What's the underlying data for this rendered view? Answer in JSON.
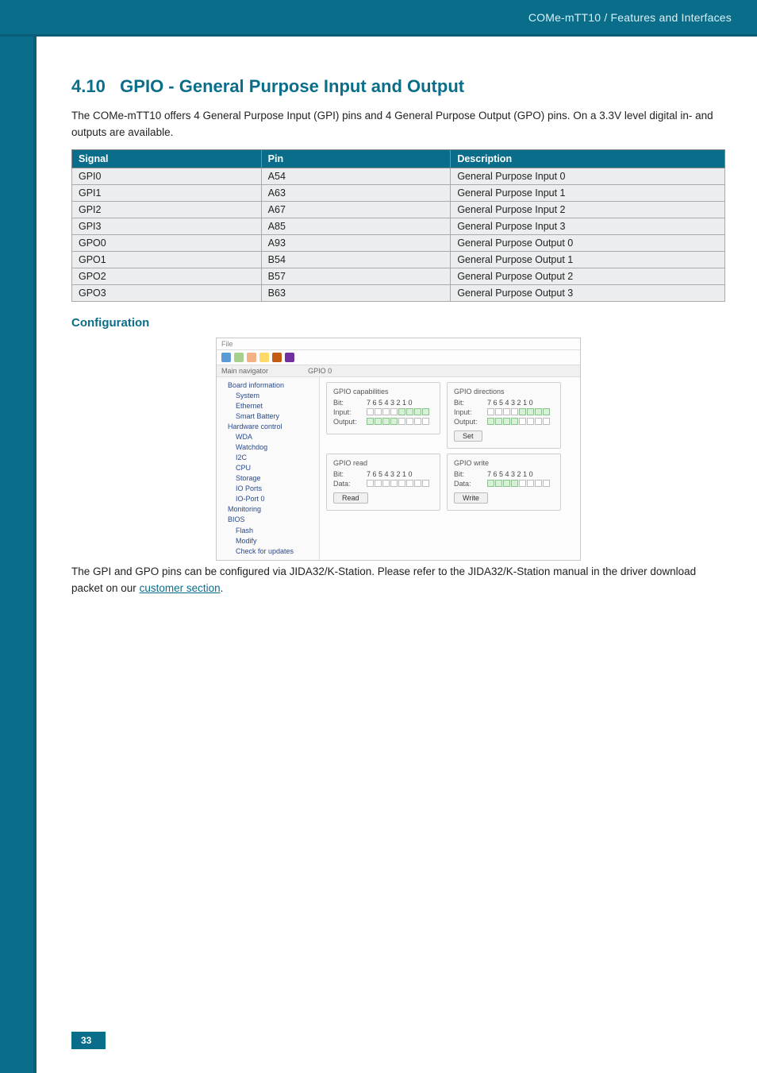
{
  "header": {
    "breadcrumb": "COMe-mTT10 / Features and Interfaces"
  },
  "section": {
    "number": "4.10",
    "title": "GPIO - General Purpose Input and Output",
    "intro": "The COMe-mTT10 offers 4 General Purpose Input (GPI) pins and 4 General Purpose Output (GPO) pins. On a 3.3V level digital in- and outputs are available."
  },
  "table": {
    "headers": {
      "signal": "Signal",
      "pin": "Pin",
      "desc": "Description"
    },
    "rows": [
      {
        "signal": "GPI0",
        "pin": "A54",
        "desc": "General Purpose Input 0"
      },
      {
        "signal": "GPI1",
        "pin": "A63",
        "desc": "General Purpose Input 1"
      },
      {
        "signal": "GPI2",
        "pin": "A67",
        "desc": "General Purpose Input 2"
      },
      {
        "signal": "GPI3",
        "pin": "A85",
        "desc": "General Purpose Input 3"
      },
      {
        "signal": "GPO0",
        "pin": "A93",
        "desc": "General Purpose Output 0"
      },
      {
        "signal": "GPO1",
        "pin": "B54",
        "desc": "General Purpose Output 1"
      },
      {
        "signal": "GPO2",
        "pin": "B57",
        "desc": "General Purpose Output 2"
      },
      {
        "signal": "GPO3",
        "pin": "B63",
        "desc": "General Purpose Output 3"
      }
    ]
  },
  "config": {
    "heading": "Configuration",
    "footnote_pre": "The GPI and GPO pins can be configured via JIDA32/K-Station. Please refer to the JIDA32/K-Station manual in the driver download packet on our ",
    "footnote_link": "customer section",
    "footnote_post": "."
  },
  "embed": {
    "file_menu": "File",
    "nav_header": "Main navigator",
    "tab": "GPIO 0",
    "tree": [
      {
        "label": "Board information",
        "lvl": 1
      },
      {
        "label": "System",
        "lvl": 2
      },
      {
        "label": "Ethernet",
        "lvl": 2
      },
      {
        "label": "Smart Battery",
        "lvl": 2
      },
      {
        "label": "Hardware control",
        "lvl": 1
      },
      {
        "label": "WDA",
        "lvl": 2
      },
      {
        "label": "Watchdog",
        "lvl": 2
      },
      {
        "label": "I2C",
        "lvl": 2
      },
      {
        "label": "CPU",
        "lvl": 2
      },
      {
        "label": "Storage",
        "lvl": 2
      },
      {
        "label": "IO Ports",
        "lvl": 2
      },
      {
        "label": "IO-Port 0",
        "lvl": 2
      },
      {
        "label": "Monitoring",
        "lvl": 1
      },
      {
        "label": "BIOS",
        "lvl": 1
      },
      {
        "label": "Flash",
        "lvl": 2
      },
      {
        "label": "Modify",
        "lvl": 2
      },
      {
        "label": "Check for updates",
        "lvl": 2
      }
    ],
    "groups": {
      "caps": {
        "title": "GPIO capabilities",
        "bit_label": "Bit:",
        "bits": "7 6 5 4 3 2 1 0",
        "input_label": "Input:",
        "output_label": "Output:"
      },
      "dirs": {
        "title": "GPIO directions",
        "bit_label": "Bit:",
        "bits": "7 6 5 4 3 2 1 0",
        "input_label": "Input:",
        "output_label": "Output:",
        "btn": "Set"
      },
      "read": {
        "title": "GPIO read",
        "bit_label": "Bit:",
        "bits": "7 6 5 4 3 2 1 0",
        "data_label": "Data:",
        "btn": "Read"
      },
      "write": {
        "title": "GPIO write",
        "bit_label": "Bit:",
        "bits": "7 6 5 4 3 2 1 0",
        "data_label": "Data:",
        "btn": "Write"
      }
    },
    "toolbar_colors": [
      "#5b9bd5",
      "#a8d08d",
      "#f4b183",
      "#ffd966",
      "#c55a11",
      "#7030a0"
    ]
  },
  "footer": {
    "page": "33"
  }
}
